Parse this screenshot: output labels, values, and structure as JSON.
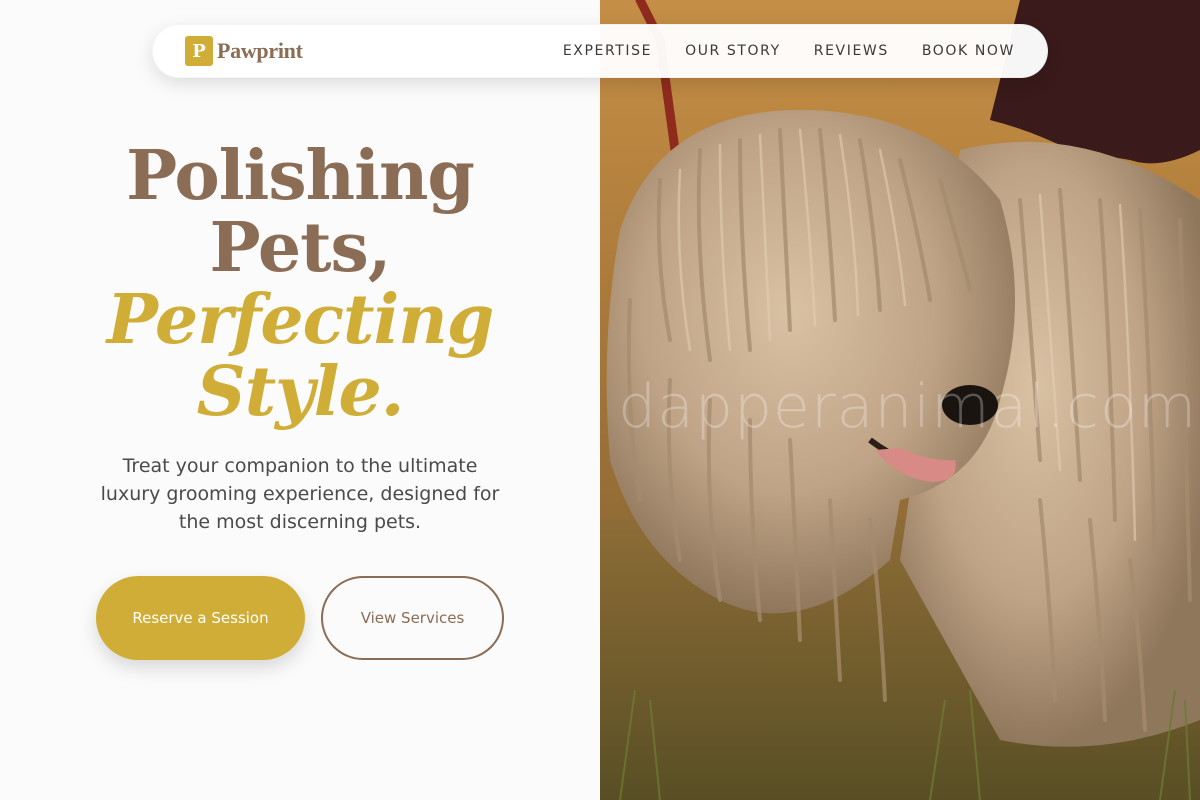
{
  "brand": {
    "logo_letter": "P",
    "name": "Pawprint",
    "accent": "#d0ad36",
    "primary_text": "#8b6c55"
  },
  "nav": {
    "links": [
      "EXPERTISE",
      "OUR STORY",
      "REVIEWS",
      "BOOK NOW"
    ]
  },
  "hero": {
    "title_line1": "Polishing",
    "title_line2": "Pets,",
    "title_line3": "Perfecting",
    "title_line4": "Style.",
    "subtitle": "Treat your companion to the ultimate luxury grooming experience, designed for the most discerning pets.",
    "primary_cta": "Reserve a Session",
    "secondary_cta": "View Services"
  },
  "photo": {
    "subject": "dog-photo",
    "watermark": "dapperanimal.com"
  }
}
